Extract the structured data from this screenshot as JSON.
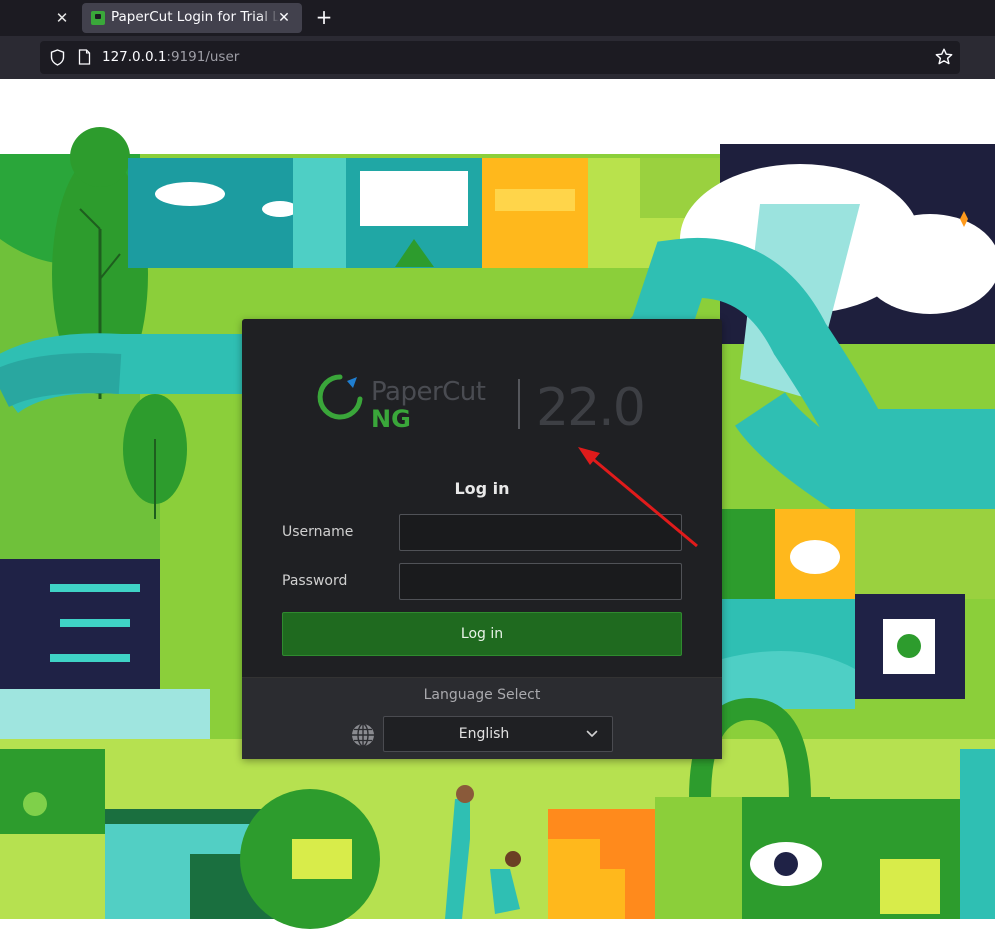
{
  "browser": {
    "active_tab_title": "PaperCut Login for Trial Licence",
    "url_host": "127.0.0.1",
    "url_rest": ":9191/user",
    "icons": [
      "close-icon",
      "papercut-favicon",
      "plus-icon",
      "shield-icon",
      "page-icon",
      "star-icon"
    ]
  },
  "brand": {
    "name": "PaperCut",
    "edition": "NG",
    "version": "22.0",
    "accent_color": "#3aa63a"
  },
  "login": {
    "title": "Log in",
    "username_label": "Username",
    "username_value": "",
    "password_label": "Password",
    "password_value": "",
    "submit_label": "Log in"
  },
  "language": {
    "label": "Language Select",
    "selected": "English"
  },
  "annotation": {
    "color": "#e01b1b"
  }
}
